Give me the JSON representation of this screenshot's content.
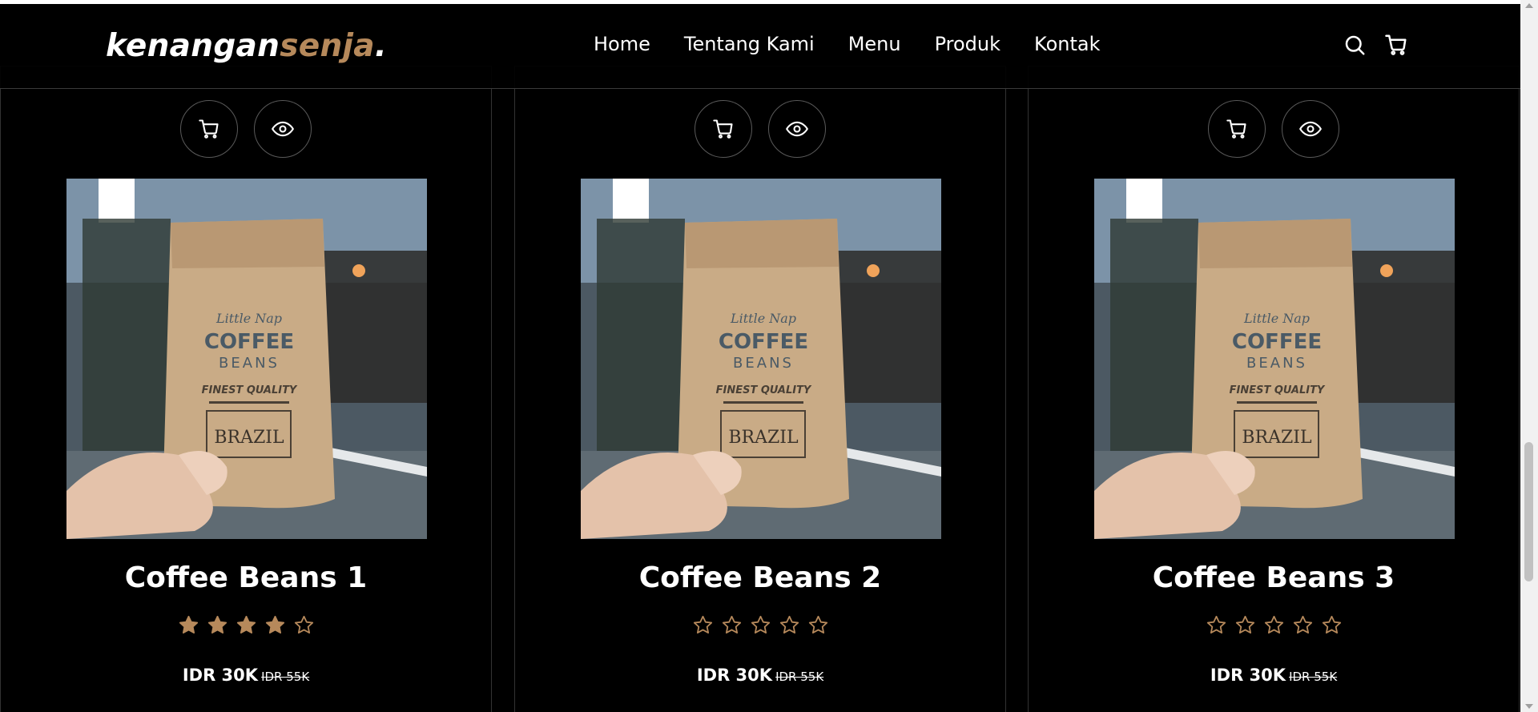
{
  "brand": {
    "part1": "kenangan",
    "part2": "senja",
    "part3": "."
  },
  "nav": {
    "links": [
      "Home",
      "Tentang Kami",
      "Menu",
      "Produk",
      "Kontak"
    ],
    "icons": [
      "search-icon",
      "shopping-cart-icon"
    ]
  },
  "colors": {
    "accent": "#b6895b",
    "background": "#000000",
    "text": "#ffffff"
  },
  "products": [
    {
      "title": "Coffee Beans 1",
      "rating": 4,
      "rating_max": 5,
      "price": "IDR 30K",
      "old_price": "IDR 55K",
      "image_text": {
        "brand": "Little Nap",
        "name_line1": "COFFEE",
        "name_line2": "BEANS",
        "quality": "FINEST QUALITY",
        "type": "BRAZIL"
      }
    },
    {
      "title": "Coffee Beans 2",
      "rating": 0,
      "rating_max": 5,
      "price": "IDR 30K",
      "old_price": "IDR 55K",
      "image_text": {
        "brand": "Little Nap",
        "name_line1": "COFFEE",
        "name_line2": "BEANS",
        "quality": "FINEST QUALITY",
        "type": "BRAZIL"
      }
    },
    {
      "title": "Coffee Beans 3",
      "rating": 0,
      "rating_max": 5,
      "price": "IDR 30K",
      "old_price": "IDR 55K",
      "image_text": {
        "brand": "Little Nap",
        "name_line1": "COFFEE",
        "name_line2": "BEANS",
        "quality": "FINEST QUALITY",
        "type": "BRAZIL"
      }
    }
  ],
  "card_actions": [
    "add-to-cart-icon",
    "view-details-icon"
  ]
}
